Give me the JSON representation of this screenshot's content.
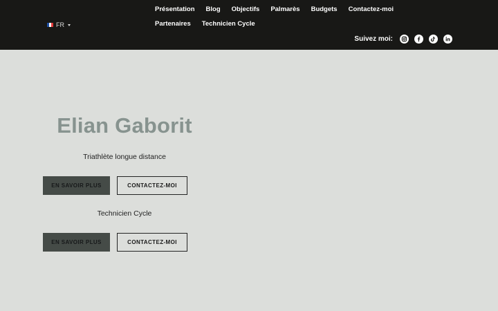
{
  "header": {
    "language": {
      "code": "FR",
      "flag_colors": [
        "#1e4fa3",
        "#ffffff",
        "#e23a3a"
      ]
    },
    "nav": [
      {
        "label": "Présentation",
        "name": "presentation"
      },
      {
        "label": "Blog",
        "name": "blog"
      },
      {
        "label": "Objectifs",
        "name": "objectifs"
      },
      {
        "label": "Palmarès",
        "name": "palmares"
      },
      {
        "label": "Budgets",
        "name": "budgets"
      },
      {
        "label": "Contactez-moi",
        "name": "contactez-moi"
      },
      {
        "label": "Partenaires",
        "name": "partenaires"
      },
      {
        "label": "Technicien Cycle",
        "name": "technicien-cycle"
      }
    ],
    "social": {
      "label": "Suivez moi:",
      "icons": [
        "instagram-icon",
        "facebook-icon",
        "tiktok-icon",
        "linkedin-icon"
      ]
    }
  },
  "hero": {
    "title": "Elian Gaborit",
    "sections": [
      {
        "subtitle": "Triathlète longue distance",
        "primary_button": "EN SAVOIR PLUS",
        "secondary_button": "CONTACTEZ-MOI"
      },
      {
        "subtitle": "Technicien Cycle",
        "primary_button": "EN SAVOIR PLUS",
        "secondary_button": "CONTACTEZ-MOI"
      }
    ]
  },
  "colors": {
    "header_bg": "#181816",
    "page_bg": "#dcdedb",
    "title": "#87938f",
    "button_dark": "#454b47"
  }
}
